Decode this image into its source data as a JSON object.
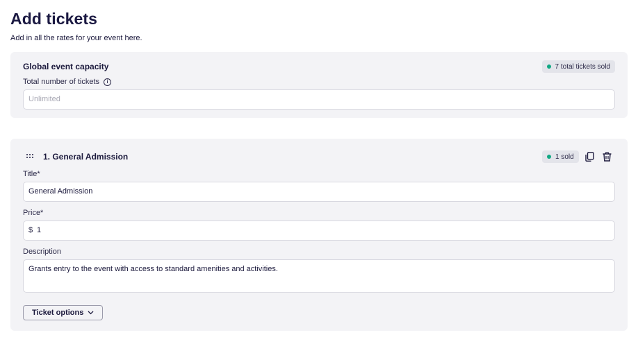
{
  "header": {
    "title": "Add tickets",
    "subtitle": "Add in all the rates for your event here."
  },
  "capacity": {
    "heading": "Global event capacity",
    "sold_badge": "7 total tickets sold",
    "total_label": "Total number of tickets",
    "total_placeholder": "Unlimited",
    "info_icon": "i"
  },
  "ticket": {
    "heading": "1. General Admission",
    "sold_badge": "1 sold",
    "title_label": "Title*",
    "title_value": "General Admission",
    "price_label": "Price*",
    "currency": "$",
    "price_value": "1",
    "description_label": "Description",
    "description_value": "Grants entry to the event with access to standard amenities and activities.",
    "options_button": "Ticket options",
    "icons": [
      "drag-handle-icon",
      "copy-icon",
      "trash-icon",
      "chevron-down-icon"
    ]
  },
  "colors": {
    "title": "#1b1942",
    "card_bg": "#f3f3f6",
    "status_dot": "#11a884"
  }
}
